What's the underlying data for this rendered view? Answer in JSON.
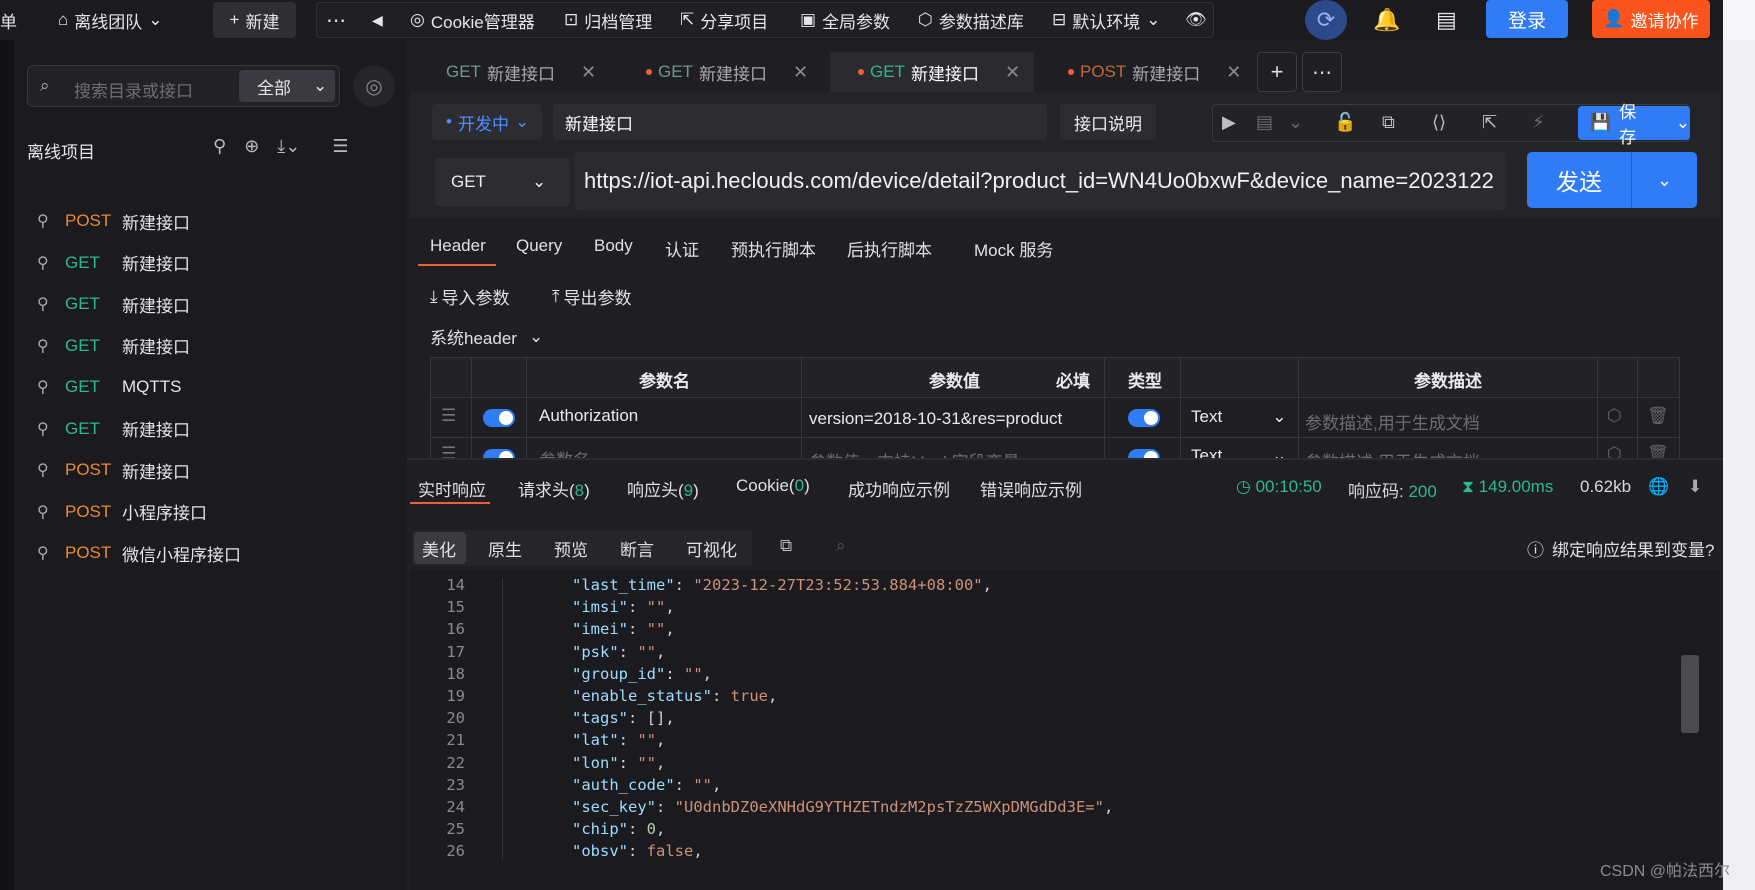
{
  "topbar": {
    "cut_text": "单",
    "team": "离线团队",
    "new_label": "新建",
    "items": [
      {
        "icon": "cookie-icon",
        "label": "Cookie管理器"
      },
      {
        "icon": "archive-icon",
        "label": "归档管理"
      },
      {
        "icon": "share-icon",
        "label": "分享项目"
      },
      {
        "icon": "global-params-icon",
        "label": "全局参数"
      },
      {
        "icon": "cube-icon",
        "label": "参数描述库"
      },
      {
        "icon": "env-icon",
        "label": "默认环境"
      }
    ],
    "login": "登录",
    "invite": "邀请协作"
  },
  "sidebar": {
    "search_placeholder": "搜索目录或接口",
    "filter": "全部",
    "project_title": "离线项目",
    "apis": [
      {
        "method": "POST",
        "name": "新建接口"
      },
      {
        "method": "GET",
        "name": "新建接口"
      },
      {
        "method": "GET",
        "name": "新建接口"
      },
      {
        "method": "GET",
        "name": "新建接口"
      },
      {
        "method": "GET",
        "name": "MQTTS"
      },
      {
        "method": "GET",
        "name": "新建接口"
      },
      {
        "method": "POST",
        "name": "新建接口"
      },
      {
        "method": "POST",
        "name": "小程序接口"
      },
      {
        "method": "POST",
        "name": "微信小程序接口"
      }
    ]
  },
  "tabs": [
    {
      "method": "GET",
      "name": "新建接口"
    },
    {
      "method": "GET",
      "name": "新建接口"
    },
    {
      "method": "GET",
      "name": "新建接口"
    },
    {
      "method": "POST",
      "name": "新建接口"
    }
  ],
  "request": {
    "status": "开发中",
    "name": "新建接口",
    "doc_label": "接口说明",
    "save_label": "保存",
    "method": "GET",
    "url": "https://iot-api.heclouds.com/device/detail?product_id=WN4Uo0bxwF&device_name=2023122",
    "send_label": "发送",
    "sub_tabs": [
      "Header",
      "Query",
      "Body",
      "认证",
      "预执行脚本",
      "后执行脚本",
      "Mock 服务"
    ],
    "import_params": "导入参数",
    "export_params": "导出参数",
    "sys_header": "系统header"
  },
  "param_table": {
    "headers": [
      "参数名",
      "参数值",
      "必填",
      "类型",
      "参数描述"
    ],
    "rows": [
      {
        "name": "Authorization",
        "value": "version=2018-10-31&res=product",
        "type": "Text",
        "desc_placeholder": "参数描述,用于生成文档"
      },
      {
        "name_placeholder": "参数名",
        "value_placeholder": "参数值，支持Mock字段变量",
        "type": "Text",
        "desc_placeholder": "参数描述,用于生成文档"
      }
    ]
  },
  "response": {
    "tabs": {
      "realtime": "实时响应",
      "req_headers": "请求头(",
      "req_headers_count": "8",
      "resp_headers": "响应头(",
      "resp_headers_count": "9",
      "cookie": "Cookie(",
      "cookie_count": "0",
      "close_paren": ")",
      "success_example": "成功响应示例",
      "error_example": "错误响应示例"
    },
    "time": "00:10:50",
    "code_label": "响应码:",
    "code": "200",
    "duration": "149.00ms",
    "size": "0.62kb",
    "view_tabs": [
      "美化",
      "原生",
      "预览",
      "断言",
      "可视化"
    ],
    "bind_help": "绑定响应结果到变量?",
    "code_lines": [
      {
        "ln": "14",
        "key": "\"last_time\"",
        "val": "\"2023-12-27T23:52:53.884+08:00\"",
        "vtype": "s"
      },
      {
        "ln": "15",
        "key": "\"imsi\"",
        "val": "\"\"",
        "vtype": "s"
      },
      {
        "ln": "16",
        "key": "\"imei\"",
        "val": "\"\"",
        "vtype": "s"
      },
      {
        "ln": "17",
        "key": "\"psk\"",
        "val": "\"\"",
        "vtype": "s"
      },
      {
        "ln": "18",
        "key": "\"group_id\"",
        "val": "\"\"",
        "vtype": "s"
      },
      {
        "ln": "19",
        "key": "\"enable_status\"",
        "val": "true",
        "vtype": "b"
      },
      {
        "ln": "20",
        "key": "\"tags\"",
        "val": "[]",
        "vtype": "p"
      },
      {
        "ln": "21",
        "key": "\"lat\"",
        "val": "\"\"",
        "vtype": "s"
      },
      {
        "ln": "22",
        "key": "\"lon\"",
        "val": "\"\"",
        "vtype": "s"
      },
      {
        "ln": "23",
        "key": "\"auth_code\"",
        "val": "\"\"",
        "vtype": "s"
      },
      {
        "ln": "24",
        "key": "\"sec_key\"",
        "val": "\"U0dnbDZ0eXNHdG9YTHZETndzM2psTzZ5WXpDMGdDd3E=\"",
        "vtype": "s"
      },
      {
        "ln": "25",
        "key": "\"chip\"",
        "val": "0",
        "vtype": "n"
      },
      {
        "ln": "26",
        "key": "\"obsv\"",
        "val": "false",
        "vtype": "b"
      }
    ]
  },
  "watermark": "CSDN @帕法西尔",
  "colors": {
    "accent": "#2f7cf6",
    "invite": "#fa541c",
    "get": "#2fb88c",
    "post": "#e88a2f",
    "tab_underline": "#e8603c"
  }
}
